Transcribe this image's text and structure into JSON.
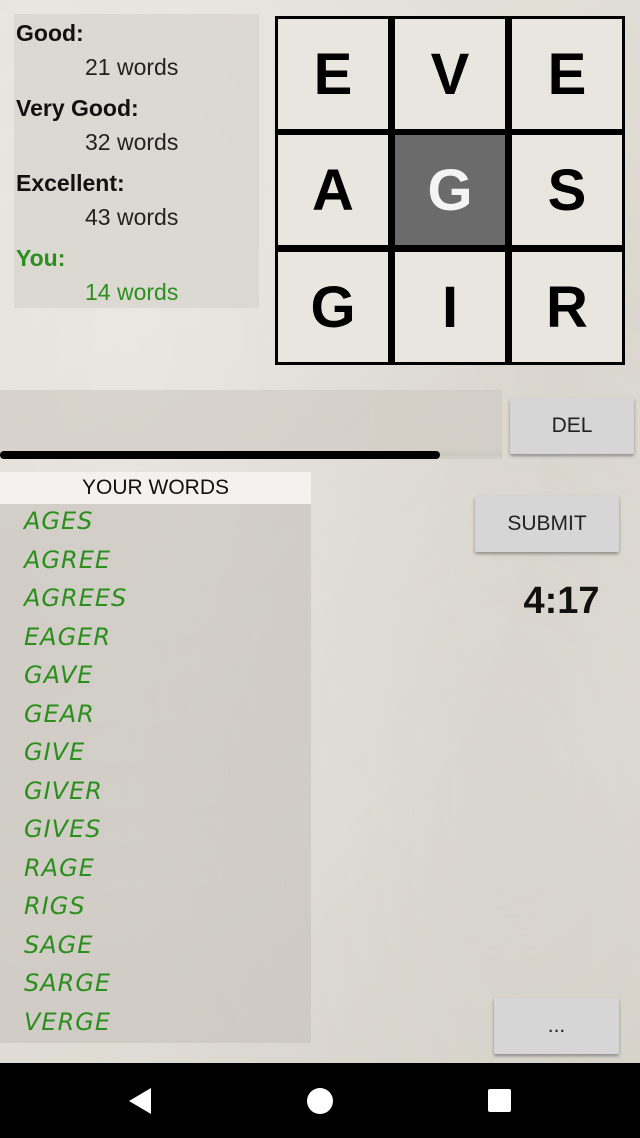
{
  "scores": {
    "good_label": "Good:",
    "good_value": "21 words",
    "very_good_label": "Very Good:",
    "very_good_value": "32 words",
    "excellent_label": "Excellent:",
    "excellent_value": "43 words",
    "you_label": "You:",
    "you_value": "14 words"
  },
  "grid": {
    "letters": [
      "E",
      "V",
      "E",
      "A",
      "G",
      "S",
      "G",
      "I",
      "R"
    ],
    "selected_index": 4
  },
  "input": {
    "current_word": "",
    "time_progress": 0.876
  },
  "buttons": {
    "del": "DEL",
    "submit": "SUBMIT",
    "more": "..."
  },
  "timer": "4:17",
  "words": {
    "header": "YOUR WORDS",
    "items": [
      "AGES",
      "AGREE",
      "AGREES",
      "EAGER",
      "GAVE",
      "GEAR",
      "GIVE",
      "GIVER",
      "GIVES",
      "RAGE",
      "RIGS",
      "SAGE",
      "SARGE",
      "VERGE"
    ]
  },
  "colors": {
    "found_word": "#2c8f1d",
    "selected_cell": "#6b6b6b"
  },
  "navbar": {
    "icons": [
      "back-icon",
      "home-icon",
      "recent-apps-icon"
    ]
  }
}
